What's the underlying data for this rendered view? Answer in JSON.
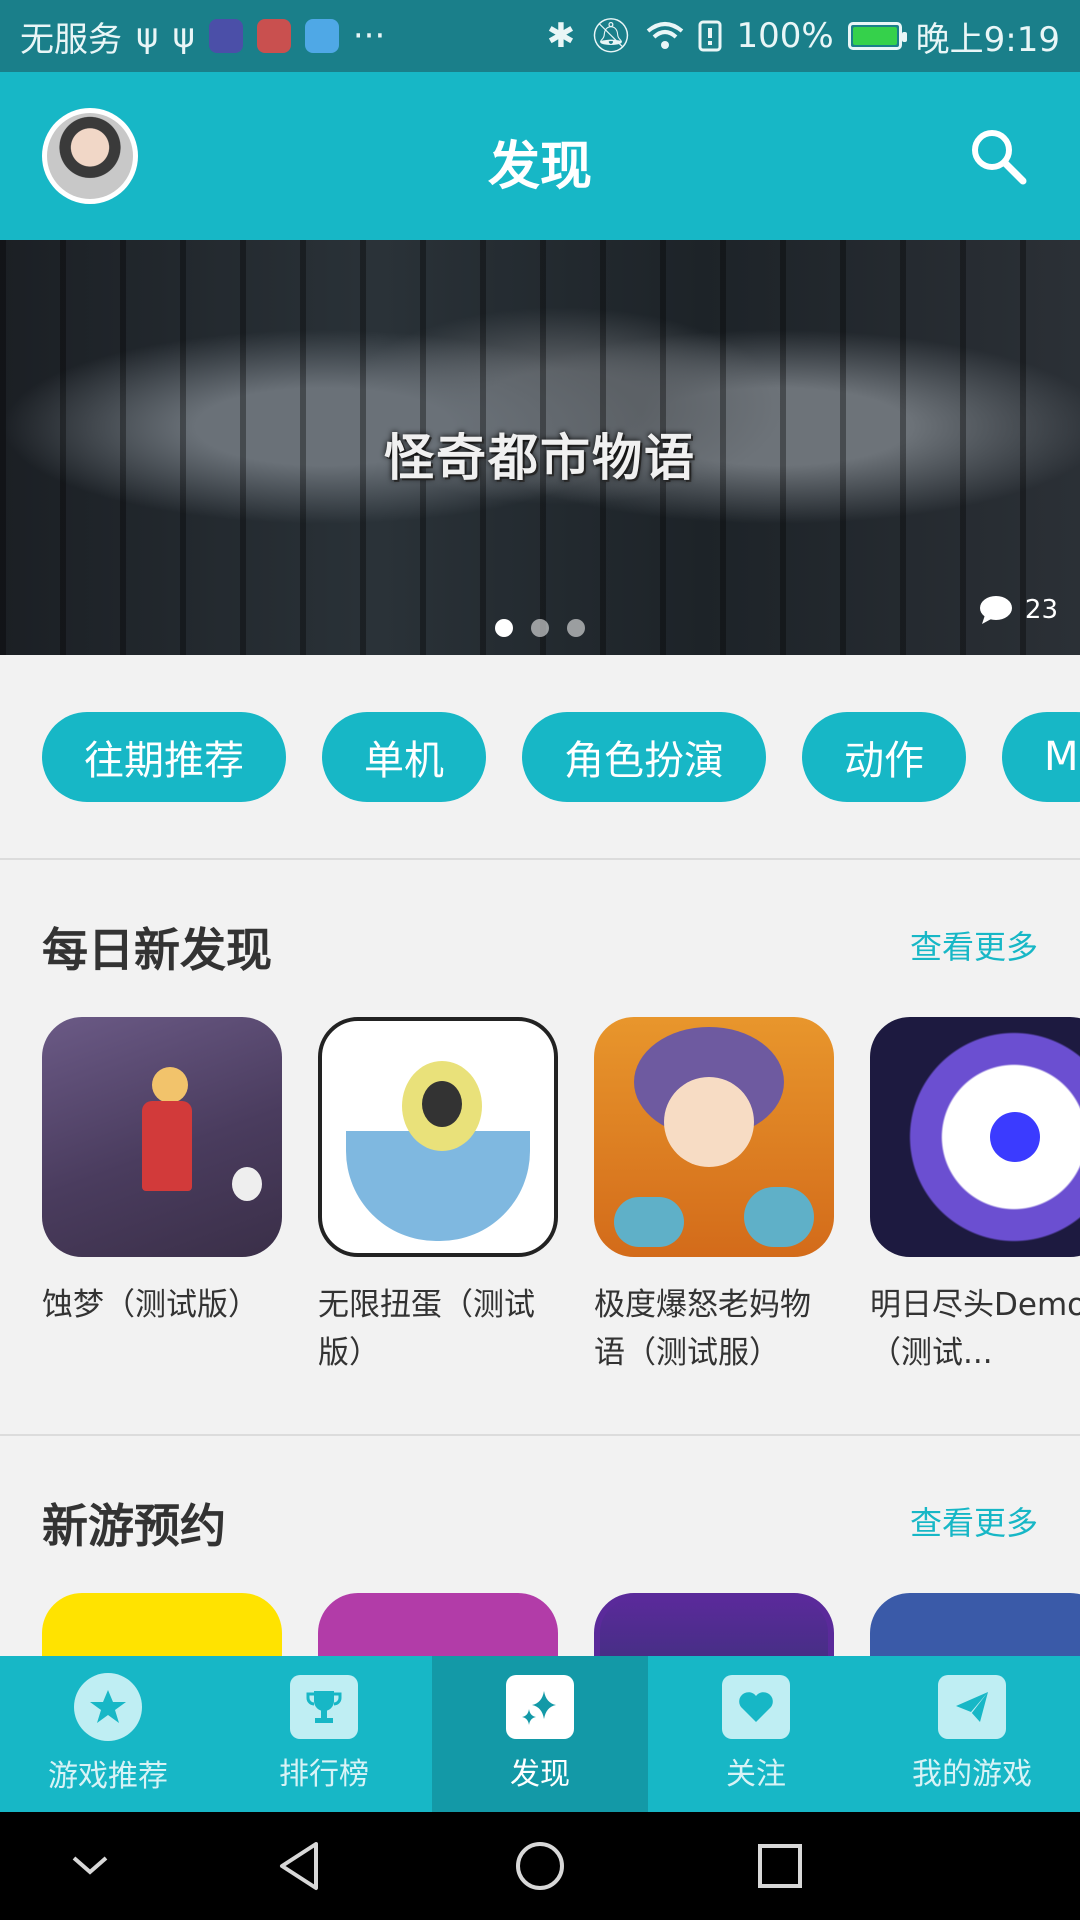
{
  "status_bar": {
    "carrier": "无服务",
    "battery": "100%",
    "battery_level": 1.0,
    "time": "晚上9:19",
    "more": "···"
  },
  "header": {
    "title": "发现"
  },
  "banner": {
    "title": "怪奇都市物语",
    "comment_count": "23",
    "page_count": 3,
    "active_page": 1
  },
  "tags": [
    "往期推荐",
    "单机",
    "角色扮演",
    "动作",
    "M"
  ],
  "sections": [
    {
      "title": "每日新发现",
      "more_label": "查看更多",
      "games": [
        {
          "name": "蚀梦（测试版）"
        },
        {
          "name": "无限扭蛋（测试版）"
        },
        {
          "name": "极度爆怒老妈物语（测试服）"
        },
        {
          "name": "明日尽头Demo（测试..."
        }
      ]
    },
    {
      "title": "新游预约",
      "more_label": "查看更多"
    }
  ],
  "bottom_nav": [
    {
      "label": "游戏推荐",
      "icon": "star-icon"
    },
    {
      "label": "排行榜",
      "icon": "trophy-icon"
    },
    {
      "label": "发现",
      "icon": "sparkle-icon",
      "active": true
    },
    {
      "label": "关注",
      "icon": "heart-icon"
    },
    {
      "label": "我的游戏",
      "icon": "paper-plane-icon"
    }
  ],
  "colors": {
    "accent": "#17b7c6",
    "status_bar": "#1a7f8a",
    "nav_active": "#1399a7"
  }
}
